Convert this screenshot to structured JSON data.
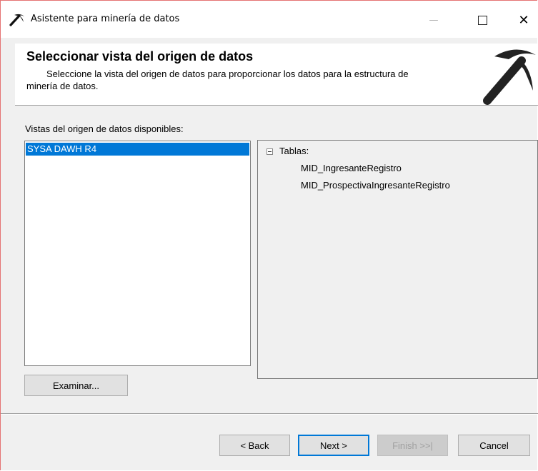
{
  "window": {
    "title": "Asistente para minería de datos",
    "minimize_glyph": "—",
    "close_glyph": "✕"
  },
  "header": {
    "title": "Seleccionar vista del origen de datos",
    "description_line1": "Seleccione la vista del origen de datos para proporcionar los datos para la estructura de",
    "description_line2": "minería de datos.",
    "logo_icon": "pickaxe-icon"
  },
  "data_source_views": {
    "label": "Vistas del origen de datos disponibles:",
    "items": [
      "SYSA DAWH R4"
    ],
    "selected": "SYSA DAWH R4",
    "browse_label": "Examinar..."
  },
  "tree": {
    "root_label": "Tablas:",
    "children": [
      "MID_IngresanteRegistro",
      "MID_ProspectivaIngresanteRegistro"
    ]
  },
  "footer": {
    "back_label": "< Back",
    "next_label": "Next >",
    "finish_label": "Finish >>|",
    "cancel_label": "Cancel"
  },
  "colors": {
    "selection": "#0078d7",
    "dialog_bg": "#f0f0f0",
    "disabled_text": "#a0a0a0"
  }
}
